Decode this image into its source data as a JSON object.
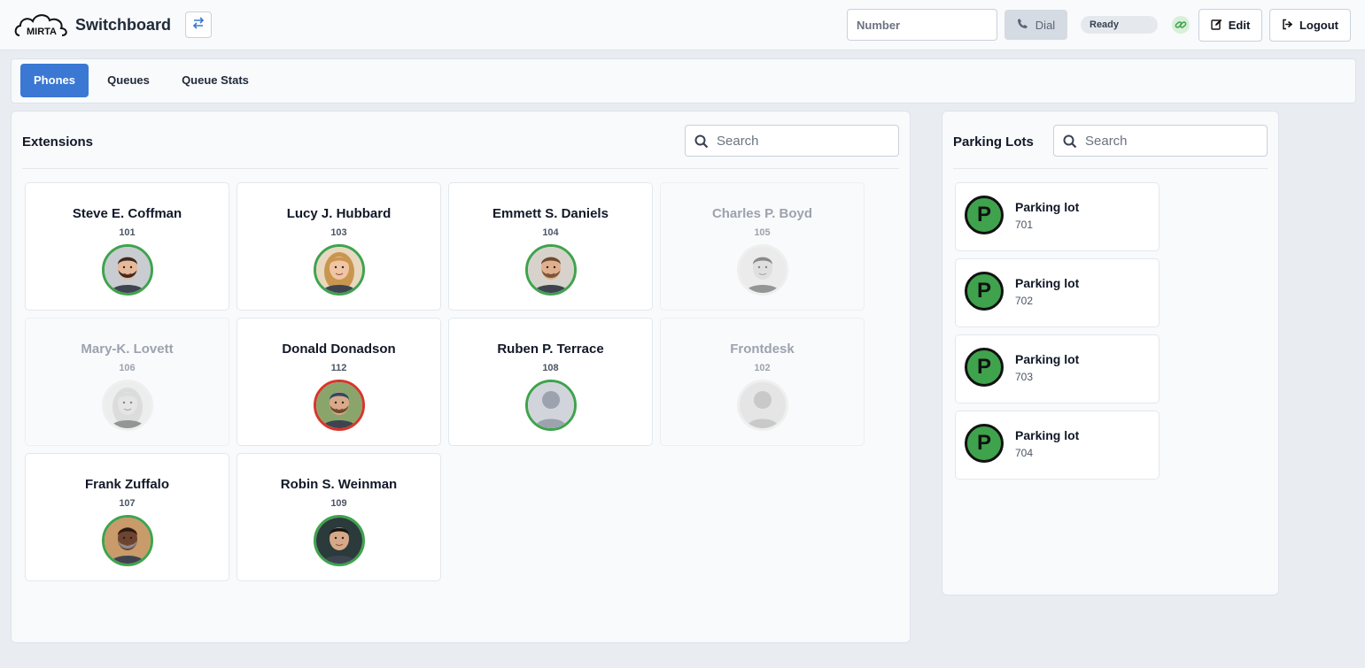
{
  "header": {
    "logo_text": "MIRTA",
    "app_title": "Switchboard",
    "number_placeholder": "Number",
    "dial_label": "Dial",
    "status_label": "Ready",
    "edit_label": "Edit",
    "logout_label": "Logout"
  },
  "tabs": [
    {
      "label": "Phones",
      "active": true
    },
    {
      "label": "Queues",
      "active": false
    },
    {
      "label": "Queue Stats",
      "active": false
    }
  ],
  "extensions": {
    "title": "Extensions",
    "search_placeholder": "Search",
    "items": [
      {
        "name": "Steve E. Coffman",
        "number": "101",
        "status": "available",
        "avatar": "man-beard"
      },
      {
        "name": "Lucy J. Hubbard",
        "number": "103",
        "status": "available",
        "avatar": "woman-blonde"
      },
      {
        "name": "Emmett S. Daniels",
        "number": "104",
        "status": "available",
        "avatar": "man-curly"
      },
      {
        "name": "Charles P. Boyd",
        "number": "105",
        "status": "offline",
        "avatar": "man-smile"
      },
      {
        "name": "Mary-K. Lovett",
        "number": "106",
        "status": "offline",
        "avatar": "woman-curly"
      },
      {
        "name": "Donald Donadson",
        "number": "112",
        "status": "busy",
        "avatar": "man-cap"
      },
      {
        "name": "Ruben P. Terrace",
        "number": "108",
        "status": "available",
        "avatar": "placeholder"
      },
      {
        "name": "Frontdesk",
        "number": "102",
        "status": "offline",
        "avatar": "placeholder"
      },
      {
        "name": "Frank Zuffalo",
        "number": "107",
        "status": "available",
        "avatar": "man-dark"
      },
      {
        "name": "Robin S. Weinman",
        "number": "109",
        "status": "available",
        "avatar": "man-asian"
      }
    ]
  },
  "parking": {
    "title": "Parking Lots",
    "search_placeholder": "Search",
    "icon_letter": "P",
    "items": [
      {
        "name": "Parking lot",
        "number": "701"
      },
      {
        "name": "Parking lot",
        "number": "702"
      },
      {
        "name": "Parking lot",
        "number": "703"
      },
      {
        "name": "Parking lot",
        "number": "704"
      }
    ]
  },
  "colors": {
    "accent": "#3a78d4",
    "available": "#3fa34d",
    "busy": "#d9352b",
    "offline": "#e5e7eb"
  }
}
